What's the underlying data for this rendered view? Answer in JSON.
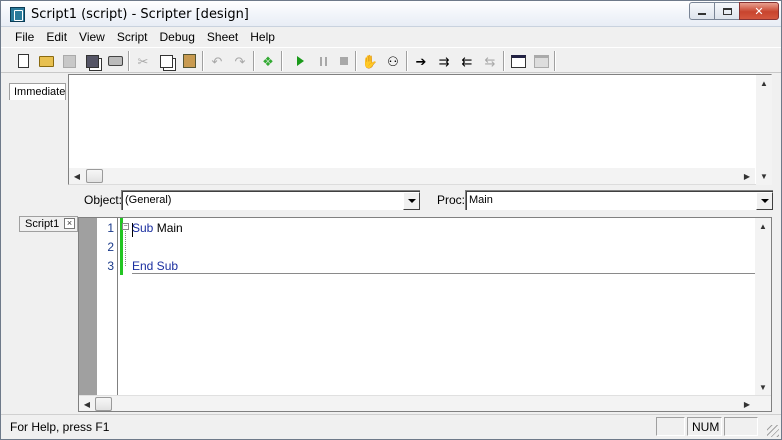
{
  "window": {
    "title": "Script1 (script) - Scripter [design]",
    "app_icon": "scripter-app-icon",
    "controls": {
      "minimize": "minimize-icon",
      "maximize": "maximize-icon",
      "close": "close-icon"
    }
  },
  "menubar": {
    "items": [
      "File",
      "Edit",
      "View",
      "Script",
      "Debug",
      "Sheet",
      "Help"
    ]
  },
  "toolbar": {
    "buttons": [
      {
        "icon": "new-document-icon",
        "enabled": true
      },
      {
        "icon": "open-folder-icon",
        "enabled": true
      },
      {
        "icon": "save-icon",
        "enabled": false
      },
      {
        "icon": "save-all-icon",
        "enabled": true
      },
      {
        "icon": "print-icon",
        "enabled": true
      },
      {
        "icon": "cut-icon",
        "enabled": false
      },
      {
        "icon": "copy-icon",
        "enabled": true
      },
      {
        "icon": "paste-icon",
        "enabled": true
      },
      {
        "icon": "undo-icon",
        "enabled": false
      },
      {
        "icon": "redo-icon",
        "enabled": false
      },
      {
        "icon": "references-icon",
        "enabled": true
      },
      {
        "icon": "run-icon",
        "enabled": true
      },
      {
        "icon": "pause-icon",
        "enabled": false
      },
      {
        "icon": "stop-icon",
        "enabled": false
      },
      {
        "icon": "breakpoint-hand-icon",
        "enabled": true
      },
      {
        "icon": "quick-watch-icon",
        "enabled": true
      },
      {
        "icon": "step-into-icon",
        "enabled": true
      },
      {
        "icon": "step-over-icon",
        "enabled": true
      },
      {
        "icon": "step-out-icon",
        "enabled": true
      },
      {
        "icon": "step-to-cursor-icon",
        "enabled": false
      },
      {
        "icon": "userform-icon",
        "enabled": true
      },
      {
        "icon": "properties-icon",
        "enabled": false
      }
    ]
  },
  "immediate": {
    "tab_label": "Immediate",
    "content": ""
  },
  "selectors": {
    "object_label": "Object:",
    "object_value": "(General)",
    "proc_label": "Proc:",
    "proc_value": "Main"
  },
  "editor": {
    "tab_label": "Script1",
    "tab_close": "×",
    "lines": [
      {
        "number": "1",
        "keyword": "Sub",
        "rest": " Main"
      },
      {
        "number": "2",
        "keyword": "",
        "rest": ""
      },
      {
        "number": "3",
        "keyword": "End Sub",
        "rest": ""
      }
    ]
  },
  "statusbar": {
    "help_text": "For Help, press F1",
    "num_indicator": "NUM"
  }
}
